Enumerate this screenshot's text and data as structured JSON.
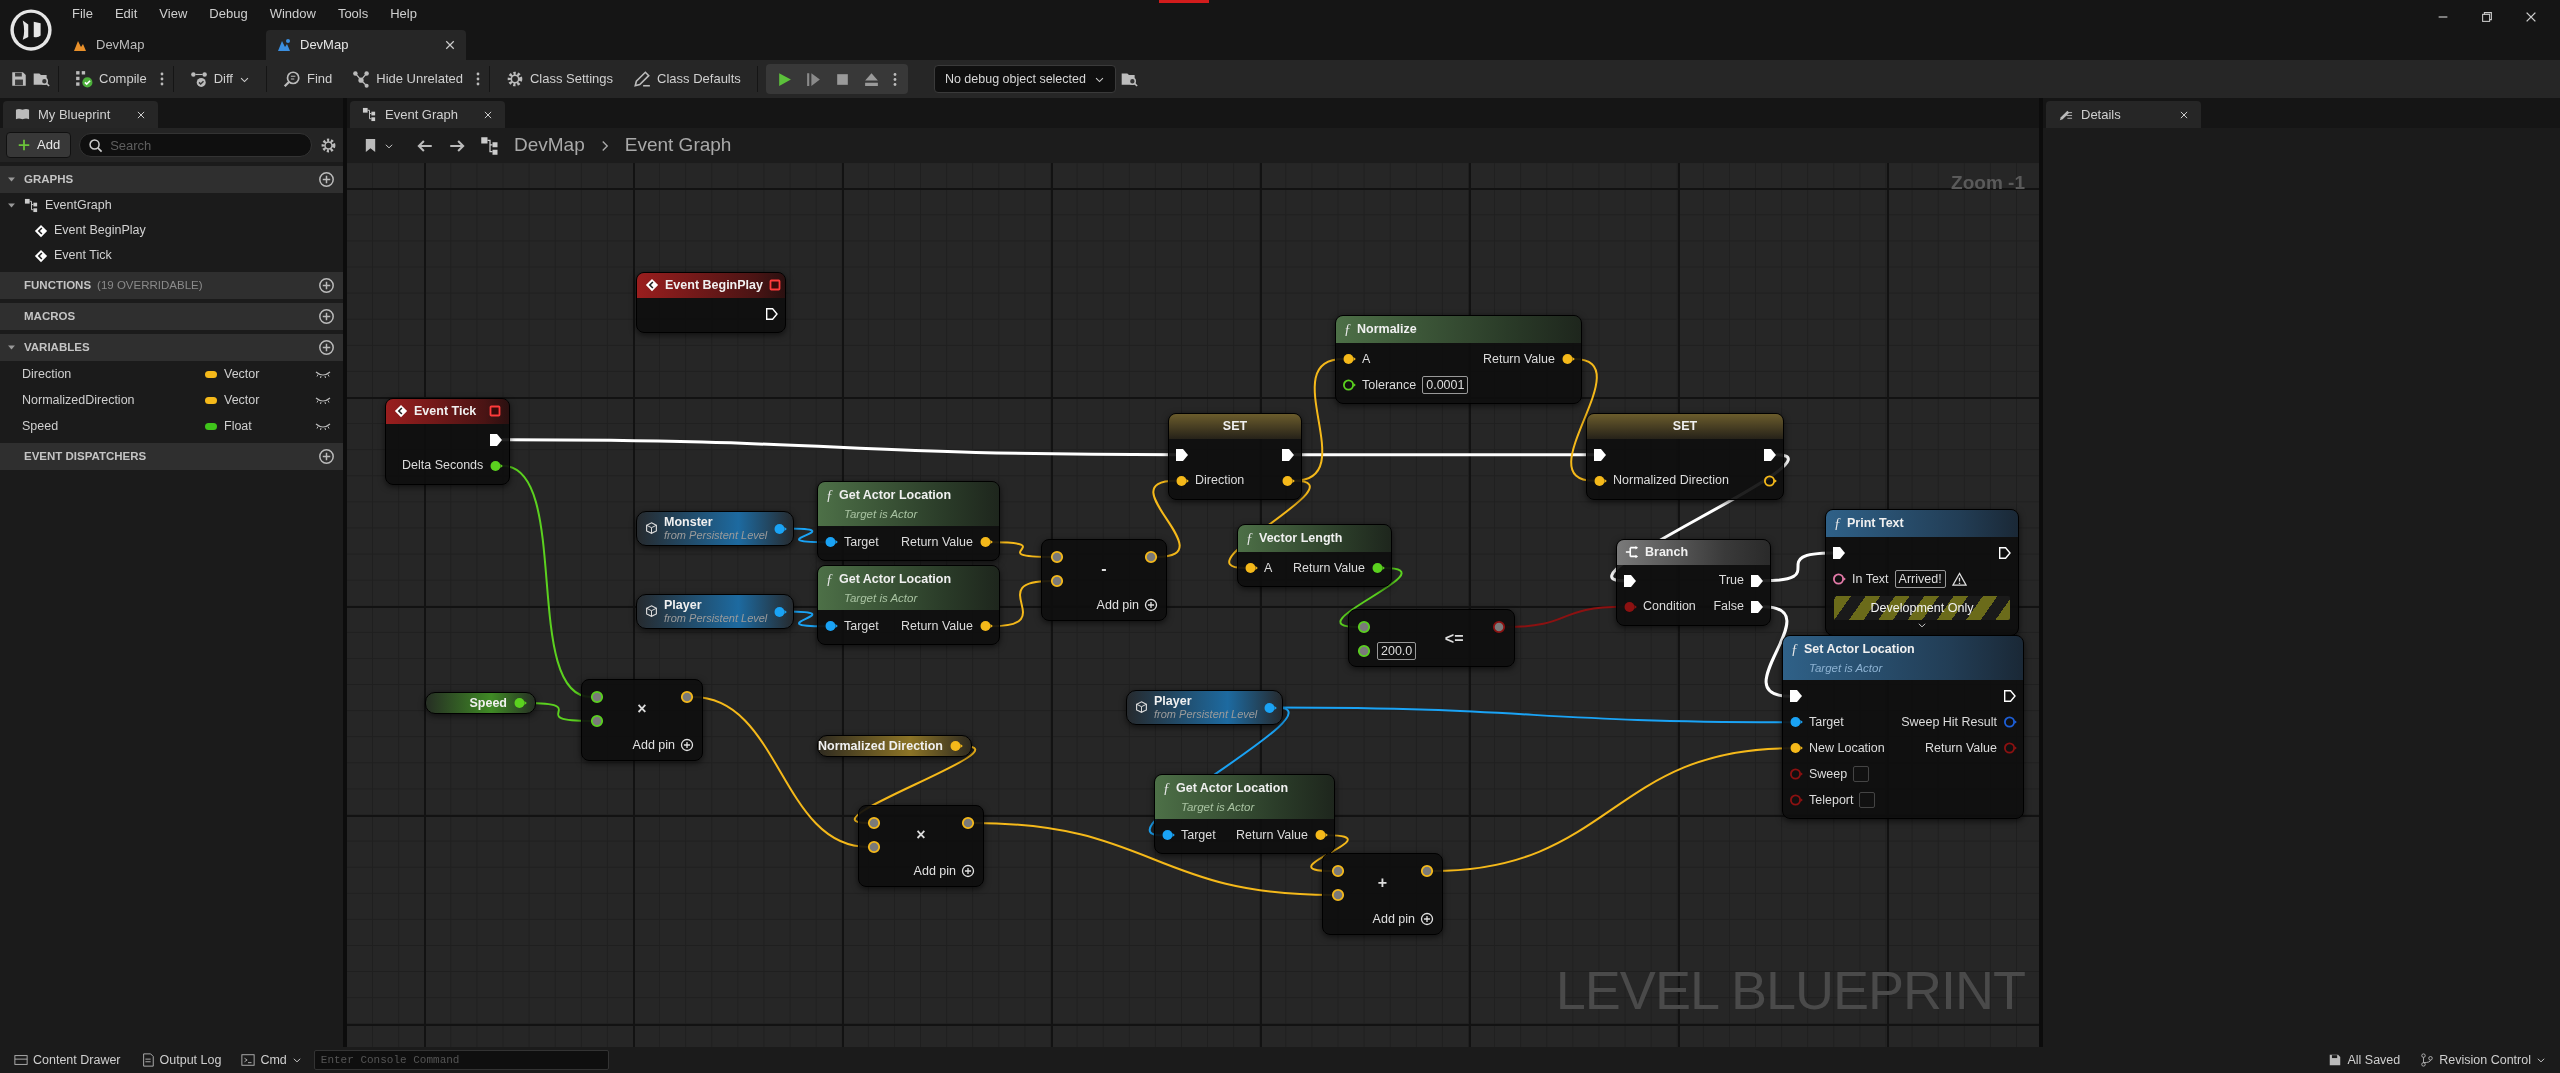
{
  "menu": [
    "File",
    "Edit",
    "View",
    "Debug",
    "Window",
    "Tools",
    "Help"
  ],
  "doc_tabs": [
    {
      "label": "DevMap",
      "selected": false
    },
    {
      "label": "DevMap",
      "selected": true
    }
  ],
  "toolbar": {
    "items": [
      {
        "kind": "compile",
        "label": "Compile",
        "dropdown": false,
        "more": true
      },
      {
        "kind": "diff",
        "label": "Diff",
        "dropdown": true,
        "more": false
      },
      {
        "kind": "find",
        "label": "Find",
        "dropdown": false,
        "more": false
      },
      {
        "kind": "hide",
        "label": "Hide Unrelated",
        "dropdown": false,
        "more": true
      },
      {
        "kind": "settings",
        "label": "Class Settings",
        "dropdown": false,
        "more": false
      },
      {
        "kind": "defaults",
        "label": "Class Defaults",
        "dropdown": false,
        "more": false
      }
    ],
    "debug_object": "No debug object selected"
  },
  "my_blueprint": {
    "tab": "My Blueprint",
    "add": "Add",
    "search_placeholder": "Search",
    "sections": [
      {
        "title": "GRAPHS",
        "expanded": true,
        "items": [
          {
            "label": "EventGraph",
            "expanded": true,
            "children": [
              {
                "label": "Event BeginPlay"
              },
              {
                "label": "Event Tick"
              }
            ]
          }
        ]
      },
      {
        "title": "FUNCTIONS",
        "note": "(19 OVERRIDABLE)",
        "expanded": false
      },
      {
        "title": "MACROS",
        "expanded": false
      },
      {
        "title": "VARIABLES",
        "expanded": true,
        "variables": [
          {
            "name": "Direction",
            "type": "Vector",
            "color": "#f5b91a"
          },
          {
            "name": "NormalizedDirection",
            "type": "Vector",
            "color": "#f5b91a"
          },
          {
            "name": "Speed",
            "type": "Float",
            "color": "#3fc41a"
          }
        ]
      },
      {
        "title": "EVENT DISPATCHERS",
        "expanded": false
      }
    ]
  },
  "graph": {
    "tab": "Event Graph",
    "breadcrumb": [
      "DevMap",
      "Event Graph"
    ],
    "zoom": "Zoom -1",
    "watermark": "LEVEL BLUEPRINT",
    "nodes": [
      {
        "kind": "event",
        "title": "Event BeginPlay",
        "outputs": [
          {
            "kind": "exec"
          }
        ]
      },
      {
        "kind": "event",
        "title": "Event Tick",
        "outputs": [
          {
            "kind": "exec"
          },
          {
            "kind": "float",
            "label": "Delta Seconds"
          }
        ]
      },
      {
        "kind": "pure",
        "glyph": "ƒ",
        "title": "Normalize",
        "inputs": [
          {
            "kind": "vector",
            "label": "A"
          },
          {
            "kind": "float",
            "label": "Tolerance",
            "value": "0.0001"
          }
        ],
        "outputs": [
          {
            "kind": "vector",
            "label": "Return Value"
          }
        ]
      },
      {
        "kind": "set",
        "title": "SET",
        "inputs": [
          {
            "kind": "exec"
          },
          {
            "kind": "vector",
            "label": "Direction"
          }
        ],
        "outputs": [
          {
            "kind": "exec"
          },
          {
            "kind": "vector"
          }
        ]
      },
      {
        "kind": "set",
        "title": "SET",
        "inputs": [
          {
            "kind": "exec"
          },
          {
            "kind": "vector",
            "label": "Normalized Direction"
          }
        ],
        "outputs": [
          {
            "kind": "exec"
          },
          {
            "kind": "vector"
          }
        ]
      },
      {
        "kind": "variable",
        "title": "Monster",
        "subtitle": "from Persistent Level",
        "outputs": [
          {
            "kind": "object"
          }
        ]
      },
      {
        "kind": "pure",
        "glyph": "ƒ",
        "title": "Get Actor Location",
        "subtitle": "Target is Actor",
        "inputs": [
          {
            "kind": "object",
            "label": "Target"
          }
        ],
        "outputs": [
          {
            "kind": "vector",
            "label": "Return Value"
          }
        ]
      },
      {
        "kind": "variable",
        "title": "Player",
        "subtitle": "from Persistent Level",
        "outputs": [
          {
            "kind": "object"
          }
        ]
      },
      {
        "kind": "pure",
        "glyph": "ƒ",
        "title": "Get Actor Location",
        "subtitle": "Target is Actor",
        "inputs": [
          {
            "kind": "object",
            "label": "Target"
          }
        ],
        "outputs": [
          {
            "kind": "vector",
            "label": "Return Value"
          }
        ]
      },
      {
        "kind": "math",
        "symbol": "-",
        "footer": "Add pin",
        "inputs": [
          {
            "kind": "vector"
          },
          {
            "kind": "vector"
          }
        ],
        "outputs": [
          {
            "kind": "vector"
          }
        ]
      },
      {
        "kind": "pure",
        "glyph": "ƒ",
        "title": "Vector Length",
        "inputs": [
          {
            "kind": "vector",
            "label": "A"
          }
        ],
        "outputs": [
          {
            "kind": "float",
            "label": "Return Value"
          }
        ]
      },
      {
        "kind": "compare",
        "symbol": "<=",
        "inputs": [
          {
            "kind": "float"
          },
          {
            "kind": "float",
            "value": "200.0"
          }
        ],
        "outputs": [
          {
            "kind": "bool"
          }
        ]
      },
      {
        "kind": "branch",
        "title": "Branch",
        "inputs": [
          {
            "kind": "exec"
          },
          {
            "kind": "bool",
            "label": "Condition"
          }
        ],
        "outputs": [
          {
            "kind": "exec",
            "label": "True"
          },
          {
            "kind": "exec",
            "label": "False"
          }
        ]
      },
      {
        "kind": "call",
        "glyph": "ƒ",
        "title": "Print Text",
        "footer": "Development Only",
        "inputs": [
          {
            "kind": "exec"
          },
          {
            "kind": "text",
            "label": "In Text",
            "value": "Arrived!",
            "warning": true
          }
        ],
        "outputs": [
          {
            "kind": "exec"
          }
        ]
      },
      {
        "kind": "variable",
        "title": "Speed",
        "outputs": [
          {
            "kind": "float"
          }
        ]
      },
      {
        "kind": "math",
        "symbol": "×",
        "footer": "Add pin",
        "inputs": [
          {
            "kind": "float"
          },
          {
            "kind": "float"
          }
        ],
        "outputs": [
          {
            "kind": "vector"
          }
        ]
      },
      {
        "kind": "variable",
        "title": "Normalized Direction",
        "outputs": [
          {
            "kind": "vector"
          }
        ]
      },
      {
        "kind": "math",
        "symbol": "×",
        "footer": "Add pin",
        "inputs": [
          {
            "kind": "vector"
          },
          {
            "kind": "vector"
          }
        ],
        "outputs": [
          {
            "kind": "vector"
          }
        ]
      },
      {
        "kind": "variable",
        "title": "Player",
        "subtitle": "from Persistent Level",
        "outputs": [
          {
            "kind": "object"
          }
        ]
      },
      {
        "kind": "pure",
        "glyph": "ƒ",
        "title": "Get Actor Location",
        "subtitle": "Target is Actor",
        "inputs": [
          {
            "kind": "object",
            "label": "Target"
          }
        ],
        "outputs": [
          {
            "kind": "vector",
            "label": "Return Value"
          }
        ]
      },
      {
        "kind": "math",
        "symbol": "+",
        "footer": "Add pin",
        "inputs": [
          {
            "kind": "vector"
          },
          {
            "kind": "vector"
          }
        ],
        "outputs": [
          {
            "kind": "vector"
          }
        ]
      },
      {
        "kind": "call",
        "glyph": "ƒ",
        "title": "Set Actor Location",
        "subtitle": "Target is Actor",
        "inputs": [
          {
            "kind": "exec"
          },
          {
            "kind": "object",
            "label": "Target"
          },
          {
            "kind": "vector",
            "label": "New Location"
          },
          {
            "kind": "bool",
            "label": "Sweep",
            "checked": false
          },
          {
            "kind": "bool",
            "label": "Teleport",
            "checked": false
          }
        ],
        "outputs": [
          {
            "kind": "exec"
          },
          {
            "kind": "struct",
            "label": "Sweep Hit Result"
          },
          {
            "kind": "bool",
            "label": "Return Value"
          }
        ]
      }
    ]
  },
  "details": {
    "tab": "Details"
  },
  "status_bar": {
    "left": [
      {
        "kind": "drawer",
        "label": "Content Drawer",
        "dropdown": false
      },
      {
        "kind": "log",
        "label": "Output Log",
        "dropdown": false
      },
      {
        "kind": "cmd",
        "label": "Cmd",
        "dropdown": true
      }
    ],
    "console_placeholder": "Enter Console Command",
    "right": [
      {
        "kind": "saved",
        "label": "All Saved",
        "dropdown": false
      },
      {
        "kind": "revision",
        "label": "Revision Control",
        "dropdown": true
      }
    ]
  }
}
